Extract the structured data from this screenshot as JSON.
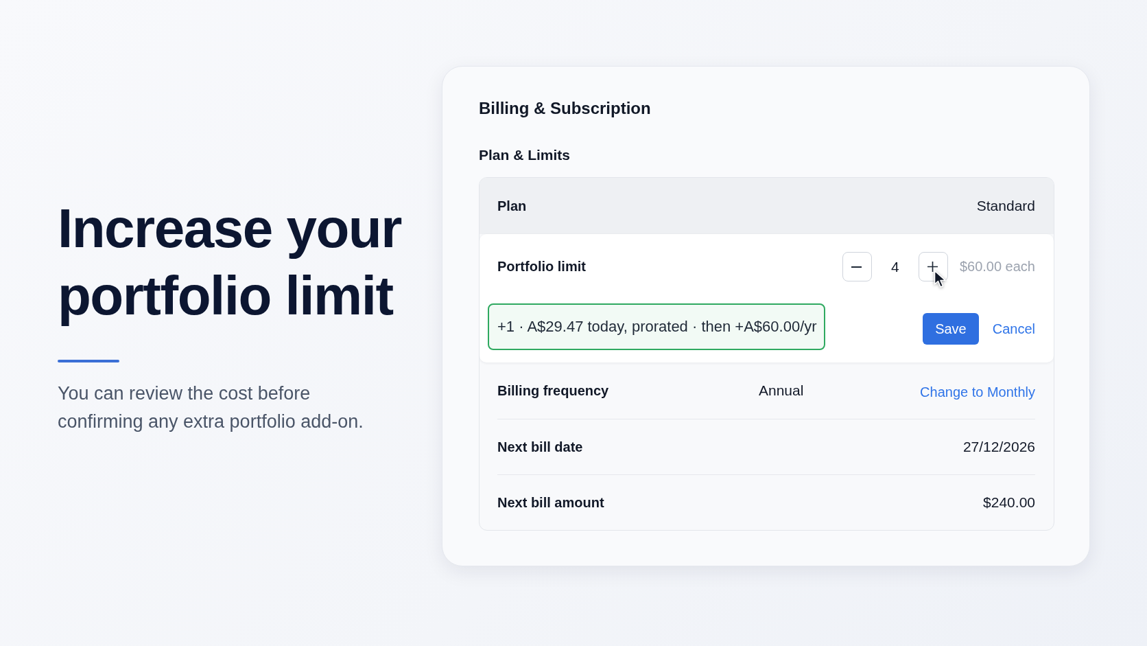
{
  "hero": {
    "headline": "Increase your portfolio limit",
    "description": "You can review the cost before confirming any extra portfolio add-on."
  },
  "card": {
    "title": "Billing & Subscription",
    "section_title": "Plan & Limits",
    "plan": {
      "label": "Plan",
      "value": "Standard"
    },
    "portfolio_limit": {
      "label": "Portfolio limit",
      "quantity": "4",
      "unit_price": "$60.00 each",
      "summary": "+1 · A$29.47 today, prorated · then +A$60.00/yr",
      "actions": [
        {
          "label": "Save",
          "kind": "primary"
        },
        {
          "label": "Cancel",
          "kind": "link"
        }
      ]
    },
    "rows": [
      {
        "label": "Billing frequency",
        "value": "Annual",
        "action": "Change to Monthly"
      },
      {
        "label": "Next bill date",
        "value": "27/12/2026"
      },
      {
        "label": "Next bill amount",
        "value": "$240.00"
      }
    ]
  }
}
